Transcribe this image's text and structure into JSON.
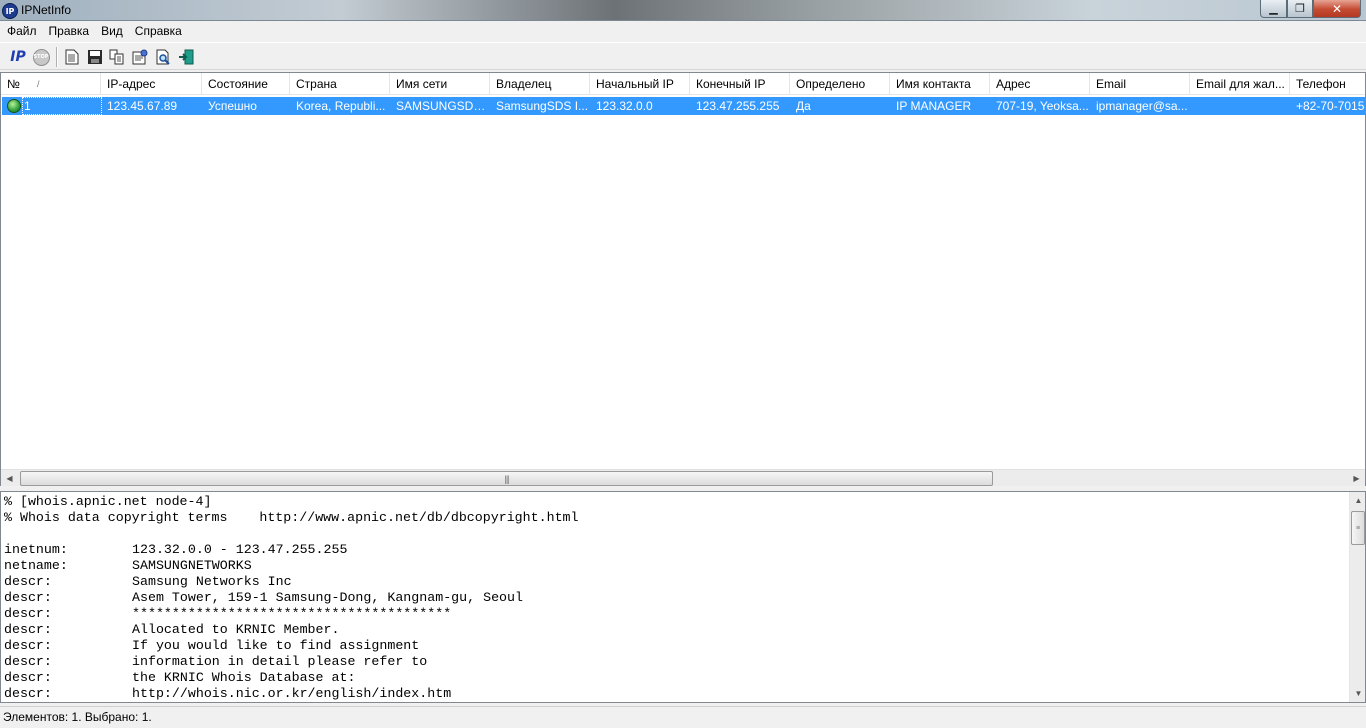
{
  "window": {
    "icon_text": "IP",
    "title": "IPNetInfo",
    "minimize_glyph": "▁",
    "maximize_glyph": "❐",
    "close_glyph": "✕"
  },
  "menu": [
    "Файл",
    "Правка",
    "Вид",
    "Справка"
  ],
  "toolbar": {
    "buttons": [
      {
        "name": "ip-lookup-icon",
        "glyph": "IP",
        "color": "#1e3fb0"
      },
      {
        "name": "stop-icon",
        "glyph": "STOP",
        "color": "#9a9a9a"
      },
      {
        "name": "document-icon"
      },
      {
        "name": "save-icon"
      },
      {
        "name": "copy-icon"
      },
      {
        "name": "properties-icon"
      },
      {
        "name": "find-icon"
      },
      {
        "name": "exit-icon"
      }
    ]
  },
  "list": {
    "columns": [
      "№",
      "IP-адрес",
      "Состояние",
      "Страна",
      "Имя сети",
      "Владелец",
      "Начальный IP",
      "Конечный IP",
      "Определено",
      "Имя контакта",
      "Адрес",
      "Email",
      "Email для жал...",
      "Телефон"
    ],
    "sort_indicator": "/",
    "rows": [
      [
        "1",
        "123.45.67.89",
        "Успешно",
        "Korea, Republi...",
        "SAMSUNGSDS...",
        "SamsungSDS I...",
        "123.32.0.0",
        "123.47.255.255",
        "Да",
        "IP MANAGER",
        "707-19, Yeoksa...",
        "ipmanager@sa...",
        "",
        "+82-70-7015-"
      ]
    ],
    "selection_color": "#3399ff"
  },
  "hscroll": {
    "left_arrow": "◀",
    "right_arrow": "▶",
    "grip": "|||"
  },
  "vscroll": {
    "up_arrow": "▲",
    "down_arrow": "▼",
    "grip": "≡"
  },
  "whois": [
    {
      "text": "% [whois.apnic.net node-4]"
    },
    {
      "text": "% Whois data copyright terms    http://www.apnic.net/db/dbcopyright.html"
    },
    {
      "text": ""
    },
    {
      "key": "inetnum:",
      "value": "123.32.0.0 - 123.47.255.255"
    },
    {
      "key": "netname:",
      "value": "SAMSUNGNETWORKS"
    },
    {
      "key": "descr:",
      "value": "Samsung Networks Inc"
    },
    {
      "key": "descr:",
      "value": "Asem Tower, 159-1 Samsung-Dong, Kangnam-gu, Seoul"
    },
    {
      "key": "descr:",
      "value": "****************************************"
    },
    {
      "key": "descr:",
      "value": "Allocated to KRNIC Member."
    },
    {
      "key": "descr:",
      "value": "If you would like to find assignment"
    },
    {
      "key": "descr:",
      "value": "information in detail please refer to"
    },
    {
      "key": "descr:",
      "value": "the KRNIC Whois Database at:"
    },
    {
      "key": "descr:",
      "value": "http://whois.nic.or.kr/english/index.htm"
    }
  ],
  "status": "Элементов: 1. Выбрано: 1."
}
